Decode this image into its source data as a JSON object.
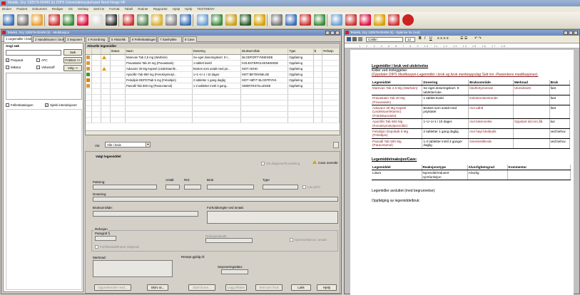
{
  "app": {
    "title": "Tekekk, Gry  130579-00499 (k)  DIPS Universitetssykehuset Nord-Norge HF"
  },
  "menu": [
    "Bruker",
    "Pasient",
    "Dokument",
    "Rediger",
    "Vis",
    "Verktøy",
    "Sett inn",
    "Format",
    "Tabell",
    "Rutiner",
    "Rapporter",
    "Hjelp",
    "Hjelp",
    "TESTMENY"
  ],
  "left_window": {
    "title": "Tekekk, Gry  130579-00499 (k) - Medikasjon",
    "tabs": [
      "1 Legemidler i bruk",
      "2 Handelsvarer i bruk",
      "3 Seponert",
      "4 Forordning",
      "5 Historikk",
      "6 Felleskatalogen",
      "7 Samhykke",
      "8 Cave"
    ],
    "search": {
      "header": "Angi søk",
      "value": "",
      "search_btn": "Søk",
      "preparat": "Preparat",
      "atc": "ATC",
      "virkestoff": "Virkestoff",
      "fritekst": "Fritekst >>",
      "mikstur": "Mikstur",
      "velg": "Velg ->",
      "felleskatalogen": "Felleskatalogen",
      "sjekk": "Sjekk interaksjoner"
    },
    "grid": {
      "title": "Aktuelle legemidler",
      "columns": [
        "",
        "",
        "",
        "Status",
        "Navn",
        "Dosering",
        "Bruksområde",
        "Type",
        "$",
        "Refusjo"
      ],
      "rows": [
        {
          "name": "Marevan Tab 2,5 mg (Warfarin)",
          "dose": "Se eget doseringskort. 9 t...",
          "use": "BLODFORTYNNENDE",
          "type": "Oppføring",
          "color": "#d89a3a",
          "warn": true
        },
        {
          "name": "Pravastatin Tab 20 mg (Pravastatin)",
          "dose": "1 tablett kveld",
          "use": "KOLESTEROLSENKENDE",
          "type": "Oppføring",
          "color": "#d89a3a",
          "warn": false
        },
        {
          "name": "Aduvanz 30 Mg Kapsel (Lisdeksamfe...",
          "dose": "Brukes som avtalt med ps...",
          "use": "MOT ADHD",
          "type": "Oppføring",
          "color": "#d89a3a",
          "warn": true
        },
        {
          "name": "Apocillin Tab 660 mg (Fenoksymetyl...",
          "dose": "1+1+1+1 i 10 dager.",
          "use": "MOT BETENNELSE",
          "type": "Oppføring",
          "color": "#3a9a3a",
          "warn": false
        },
        {
          "name": "Felodipin DEPOTtab 5 mg (Felodipin)",
          "dose": "2 tabletter 1 gang daglig",
          "use": "MOT HØYT BLODTRYKK",
          "type": "Oppføring",
          "color": "#e07b00",
          "warn": false
        },
        {
          "name": "Panodil Tab 500 mg (Paracetamol)",
          "dose": "1-2 tabletter inntil 3 gang...",
          "use": "SMERTESTILLENDE",
          "type": "Oppføring",
          "color": "#d89a3a",
          "warn": false
        }
      ]
    },
    "filter": {
      "label": "Vis:",
      "value": "Alle i bruk"
    },
    "detail": {
      "header": "Valgt legemiddel",
      "cave_label": "Cave oversikt",
      "forordning": "Vis diagnose/forordning",
      "pakning": "Pakning:",
      "antall": "Antall:",
      "ret": "Ret:",
      "bruk": "Bruk",
      "type": "Type",
      "vis_inkl": "Lav pris?",
      "dosering": "Dosering:",
      "bruksomrade": "Bruksområde:",
      "forholdsregler": "Forholdsregler ved inntak:",
      "refusjon": "Refusjon",
      "paragraf": "Paragraf §",
      "refusjonskode": "Refusjonskode",
      "gjennomfort": "Gjennomført pr. ansatt",
      "forhandsdefinerte": "Forhåndsdefinerte (skjema)",
      "merknad": "Merknad:",
      "resept": "Resept gyldig til:",
      "seponeringsdato": "Seponeringsdato:",
      "buttons": [
        "Opprett/endre med...",
        "Skriv ut...",
        "Start kurve...",
        "Legg tilbake",
        "Sett som bruk",
        "Lukk",
        "Hjelp"
      ]
    }
  },
  "right_window": {
    "title": "Tekekk, Gry  130579-00499 (k) - Epikrise for (red)",
    "font": "Calibri",
    "size": "12",
    "ruler": "1 · 2 · 3 · 4 · 5 · 6 · 7 · 8 · 9 · 10 · 11 · 12 · 13 · 14 · 15 · 16 · 17 · 18",
    "doc": {
      "heading": "Legemidler i bruk ved utskrivelse",
      "source": "Kilder ved innleggelse:",
      "note": "(Oppdater DIPS Medikasjon-Legemidler i bruk og bruk merkeoppslag Sett inn -Pasientens medikasjoner).",
      "table_headers": [
        "Legemiddel",
        "Dosering",
        "Bruksområde",
        "Merknad",
        "Bruk"
      ],
      "table_rows": [
        [
          "Marevan Tab 2,5 Mg (Warfarin)",
          "Se eget doseringskort. 9 tabletter/uke.",
          "blodfortynnende",
          "Ukesdosett",
          "fast"
        ],
        [
          "Pravastatin Tab 20 Mg (Pravastatin)",
          "1 tablett kveld",
          "kolesterolsenkende",
          "",
          "fast"
        ],
        [
          "Aduvanz 30 Mg Kapsel (Lisdeksamfetamin) (Fritekstprodukt)",
          "Brukes som avtalt med psykiater",
          "mot adhd",
          "",
          "fast"
        ],
        [
          "Apocillin Tab 660 Mg (Fenoksymetylpenicillin)",
          "1+1+1+1 i 10 dager.",
          "mot betennelse",
          "Oppstart dd.mm.åå",
          "kur"
        ],
        [
          "Felodipin Depottab 5 Mg (Felodipin)",
          "2 tabletter 1 gang daglig",
          "mot høyt blodtrykk",
          "",
          "ved behov"
        ],
        [
          "Panodil Tab 500 Mg (Paracetamol)",
          "1-2 tabletter inntil 3 ganger daglig",
          "smertestillende",
          "",
          "ved behov"
        ]
      ],
      "reaction_heading": "Legemiddelreaksjon/Cave:",
      "reaction_headers": [
        "Legemiddel",
        "Reaksjonstype",
        "Alvorlighetsgrad",
        "Kommentar"
      ],
      "reaction_rows": [
        [
          "Litium",
          "Nyresvikt/redusert nyrefunksjon",
          "Alvorlig",
          ""
        ]
      ],
      "stopped": "Legemidler avsluttet (med begrunnelse):",
      "followup": "Oppfølging av legemiddelbruk:"
    }
  }
}
